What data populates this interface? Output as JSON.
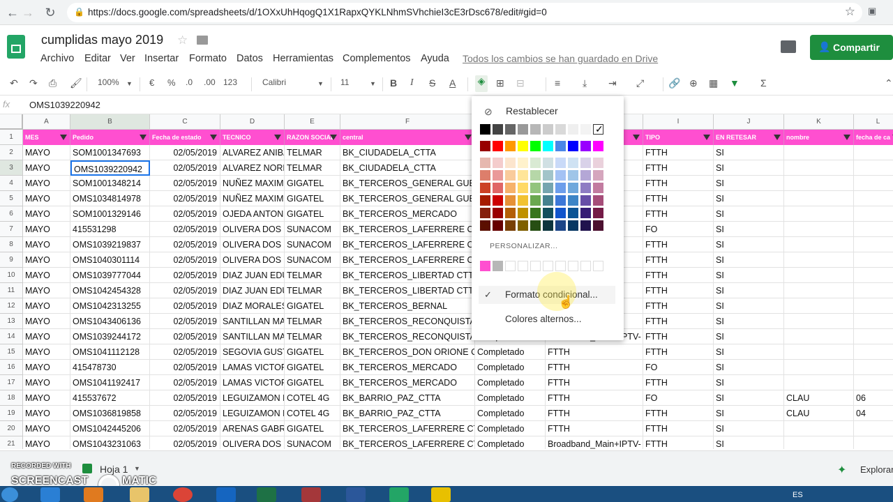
{
  "browser": {
    "url": "https://docs.google.com/spreadsheets/d/1OXxUhHqogQ1X1RapxQYKLNhmSVhchieI3cE3rDsc678/edit#gid=0"
  },
  "doc": {
    "title": "cumplidas mayo 2019",
    "saved": "Todos los cambios se han guardado en Drive",
    "share": "Compartir"
  },
  "menu": [
    "Archivo",
    "Editar",
    "Ver",
    "Insertar",
    "Formato",
    "Datos",
    "Herramientas",
    "Complementos",
    "Ayuda"
  ],
  "toolbar": {
    "zoom": "100%",
    "currency": "€",
    "percent": "%",
    "dec_less": ".0",
    "dec_more": ".00",
    "fmt": "123",
    "font": "Calibri",
    "size": "11",
    "bold": "B",
    "italic": "I",
    "strike": "S",
    "color": "A",
    "sigma": "Σ"
  },
  "formula": {
    "fx": "fx",
    "value": "OMS1039220942"
  },
  "columns": [
    "A",
    "B",
    "C",
    "D",
    "E",
    "F",
    "G",
    "H",
    "I",
    "J",
    "K",
    "L"
  ],
  "headers": [
    "MES",
    "Pedido",
    "Fecha de estado",
    "TECNICO",
    "RAZON SOCIAL",
    "central",
    "",
    "",
    "TIPO",
    "EN RETESAR",
    "nombre",
    "fecha de ca"
  ],
  "rows": [
    {
      "n": "2",
      "c": [
        "MAYO",
        "SOM1001347693",
        "02/05/2019",
        "ALVAREZ ANIBA",
        "TELMAR",
        "BK_CIUDADELA_CTTA",
        "",
        "",
        "FTTH",
        "SI",
        "",
        ""
      ]
    },
    {
      "n": "3",
      "c": [
        "MAYO",
        "OMS1039220942",
        "02/05/2019",
        "ALVAREZ NORB",
        "TELMAR",
        "BK_CIUDADELA_CTTA",
        "",
        "IPTV-",
        "FTTH",
        "SI",
        "",
        ""
      ]
    },
    {
      "n": "4",
      "c": [
        "MAYO",
        "SOM1001348214",
        "02/05/2019",
        "NUÑEZ MAXIM",
        "GIGATEL",
        "BK_TERCEROS_GENERAL GUEM",
        "",
        "",
        "FTTH",
        "SI",
        "",
        ""
      ]
    },
    {
      "n": "5",
      "c": [
        "MAYO",
        "OMS1034814978",
        "02/05/2019",
        "NUÑEZ MAXIM",
        "GIGATEL",
        "BK_TERCEROS_GENERAL GUEM",
        "",
        "IPTV-",
        "FTTH",
        "SI",
        "",
        ""
      ]
    },
    {
      "n": "6",
      "c": [
        "MAYO",
        "SOM1001329146",
        "02/05/2019",
        "OJEDA ANTONI",
        "GIGATEL",
        "BK_TERCEROS_MERCADO",
        "",
        "IPTV-",
        "FTTH",
        "SI",
        "",
        ""
      ]
    },
    {
      "n": "7",
      "c": [
        "MAYO",
        "415531298",
        "02/05/2019",
        "OLIVERA DOS S",
        "SUNACOM",
        "BK_TERCEROS_LAFERRERE CTTA",
        "",
        "",
        "FO",
        "SI",
        "",
        ""
      ]
    },
    {
      "n": "8",
      "c": [
        "MAYO",
        "OMS1039219837",
        "02/05/2019",
        "OLIVERA DOS S",
        "SUNACOM",
        "BK_TERCEROS_LAFERRERE CTTA",
        "",
        "IPTV-",
        "FTTH",
        "SI",
        "",
        ""
      ]
    },
    {
      "n": "9",
      "c": [
        "MAYO",
        "OMS1040301114",
        "02/05/2019",
        "OLIVERA DOS S",
        "SUNACOM",
        "BK_TERCEROS_LAFERRERE CTTA",
        "",
        "IPTV-",
        "FTTH",
        "SI",
        "",
        ""
      ]
    },
    {
      "n": "10",
      "c": [
        "MAYO",
        "OMS1039777044",
        "02/05/2019",
        "DIAZ JUAN EDU",
        "TELMAR",
        "BK_TERCEROS_LIBERTAD CTTA",
        "",
        "",
        "FTTH",
        "SI",
        "",
        ""
      ]
    },
    {
      "n": "11",
      "c": [
        "MAYO",
        "OMS1042454328",
        "02/05/2019",
        "DIAZ JUAN EDU",
        "TELMAR",
        "BK_TERCEROS_LIBERTAD CTTA",
        "",
        "",
        "FTTH",
        "SI",
        "",
        ""
      ]
    },
    {
      "n": "12",
      "c": [
        "MAYO",
        "OMS1042313255",
        "02/05/2019",
        "DIAZ MORALES",
        "GIGATEL",
        "BK_TERCEROS_BERNAL",
        "",
        "",
        "FTTH",
        "SI",
        "",
        ""
      ]
    },
    {
      "n": "13",
      "c": [
        "MAYO",
        "OMS1043406136",
        "02/05/2019",
        "SANTILLAN MA",
        "TELMAR",
        "BK_TERCEROS_RECONQUISTA",
        "",
        "",
        "FTTH",
        "SI",
        "",
        ""
      ]
    },
    {
      "n": "14",
      "c": [
        "MAYO",
        "OMS1039244172",
        "02/05/2019",
        "SANTILLAN MA",
        "TELMAR",
        "BK_TERCEROS_RECONQUISTA",
        "Completado",
        "Broadband_Main+IPTV-",
        "FTTH",
        "SI",
        "",
        ""
      ]
    },
    {
      "n": "15",
      "c": [
        "MAYO",
        "OMS1041112128",
        "02/05/2019",
        "SEGOVIA GUST",
        "GIGATEL",
        "BK_TERCEROS_DON ORIONE CTT",
        "Completado",
        "FTTH",
        "FTTH",
        "SI",
        "",
        ""
      ]
    },
    {
      "n": "16",
      "c": [
        "MAYO",
        "415478730",
        "02/05/2019",
        "LAMAS VICTOR",
        "GIGATEL",
        "BK_TERCEROS_MERCADO",
        "Completado",
        "FTTH",
        "FO",
        "SI",
        "",
        ""
      ]
    },
    {
      "n": "17",
      "c": [
        "MAYO",
        "OMS1041192417",
        "02/05/2019",
        "LAMAS VICTOR",
        "GIGATEL",
        "BK_TERCEROS_MERCADO",
        "Completado",
        "FTTH",
        "FTTH",
        "SI",
        "",
        ""
      ]
    },
    {
      "n": "18",
      "c": [
        "MAYO",
        "415537672",
        "02/05/2019",
        "LEGUIZAMON F",
        "COTEL 4G",
        "BK_BARRIO_PAZ_CTTA",
        "Completado",
        "FTTH",
        "FO",
        "SI",
        "CLAU",
        "06"
      ]
    },
    {
      "n": "19",
      "c": [
        "MAYO",
        "OMS1036819858",
        "02/05/2019",
        "LEGUIZAMON F",
        "COTEL 4G",
        "BK_BARRIO_PAZ_CTTA",
        "Completado",
        "FTTH",
        "FTTH",
        "SI",
        "CLAU",
        "04"
      ]
    },
    {
      "n": "20",
      "c": [
        "MAYO",
        "OMS1042445206",
        "02/05/2019",
        "ARENAS GABRI",
        "GIGATEL",
        "BK_TERCEROS_LAFERRERE CTTA",
        "Completado",
        "FTTH",
        "FTTH",
        "SI",
        "",
        ""
      ]
    },
    {
      "n": "21",
      "c": [
        "MAYO",
        "OMS1043231063",
        "02/05/2019",
        "OLIVERA DOS S",
        "SUNACOM",
        "BK_TERCEROS_LAFERRERE CTTA",
        "Completado",
        "Broadband_Main+IPTV-",
        "FTTH",
        "SI",
        "",
        ""
      ]
    }
  ],
  "popup": {
    "reset": "Restablecer",
    "custom": "PERSONALIZAR...",
    "cond": "Formato condicional...",
    "alt": "Colores alternos...",
    "gray_row": [
      "#000000",
      "#434343",
      "#666666",
      "#999999",
      "#b7b7b7",
      "#cccccc",
      "#d9d9d9",
      "#efefef",
      "#f3f3f3",
      "#ffffff"
    ],
    "bright_row": [
      "#980000",
      "#ff0000",
      "#ff9900",
      "#ffff00",
      "#00ff00",
      "#00ffff",
      "#4a86e8",
      "#0000ff",
      "#9900ff",
      "#ff00ff"
    ],
    "shades": [
      [
        "#e6b8af",
        "#f4cccc",
        "#fce5cd",
        "#fff2cc",
        "#d9ead3",
        "#d0e0e3",
        "#c9daf8",
        "#cfe2f3",
        "#d9d2e9",
        "#ead1dc"
      ],
      [
        "#dd7e6b",
        "#ea9999",
        "#f9cb9c",
        "#ffe599",
        "#b6d7a8",
        "#a2c4c9",
        "#a4c2f4",
        "#9fc5e8",
        "#b4a7d6",
        "#d5a6bd"
      ],
      [
        "#cc4125",
        "#e06666",
        "#f6b26b",
        "#ffd966",
        "#93c47d",
        "#76a5af",
        "#6d9eeb",
        "#6fa8dc",
        "#8e7cc3",
        "#c27ba0"
      ],
      [
        "#a61c00",
        "#cc0000",
        "#e69138",
        "#f1c232",
        "#6aa84f",
        "#45818e",
        "#3c78d8",
        "#3d85c6",
        "#674ea7",
        "#a64d79"
      ],
      [
        "#85200c",
        "#990000",
        "#b45f06",
        "#bf9000",
        "#38761d",
        "#134f5c",
        "#1155cc",
        "#0b5394",
        "#351c75",
        "#741b47"
      ],
      [
        "#5b0f00",
        "#660000",
        "#783f04",
        "#7f6000",
        "#274e13",
        "#0c343d",
        "#1c4587",
        "#073763",
        "#20124d",
        "#4c1130"
      ]
    ],
    "custom_colors": [
      "#ff4fd0",
      "#b7b7b7"
    ]
  },
  "sheet": {
    "tab": "Hoja 1",
    "explore": "Explorar"
  },
  "watermark": {
    "line1": "RECORDED WITH",
    "line2": "SCREENCAST",
    "line3": "MATIC"
  },
  "taskbar": {
    "lang": "ES"
  }
}
